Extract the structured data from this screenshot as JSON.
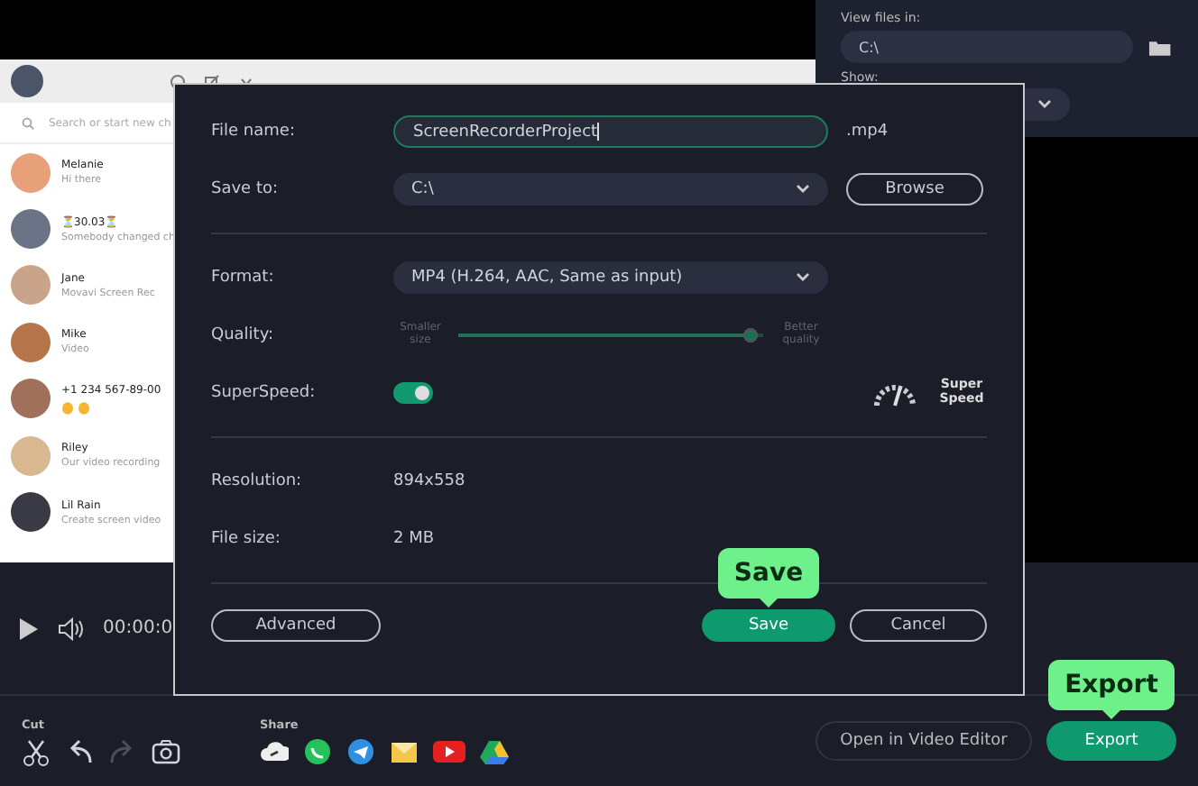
{
  "recording": {
    "search_placeholder": "Search or start new ch",
    "chats": [
      {
        "kind": "text",
        "name": "Melanie",
        "message": "Hi there",
        "color": "#e8a07a"
      },
      {
        "kind": "text",
        "name": "⏳30.03⏳",
        "message": "Somebody changed ch",
        "color": "#6a7486"
      },
      {
        "kind": "text",
        "name": "Jane",
        "message": "Movavi Screen Rec",
        "color": "#c9a48a"
      },
      {
        "kind": "text",
        "name": "Mike",
        "message": "Video",
        "color": "#b5744a"
      },
      {
        "kind": "emoji",
        "name": "+1 234 567-89-00",
        "color": "#a0705a"
      },
      {
        "kind": "text",
        "name": "Riley",
        "message": "Our video recording",
        "color": "#d8b890"
      },
      {
        "kind": "text",
        "name": "Lil Rain",
        "message": "Create screen video",
        "color": "#3a3a44"
      }
    ]
  },
  "files_panel": {
    "view_label": "View files in:",
    "folder": "C:\\",
    "show_label": "Show:"
  },
  "player": {
    "time": "00:00:0"
  },
  "dialog": {
    "file_name": {
      "label": "File name:",
      "value": "ScreenRecorderProject",
      "extension": ".mp4"
    },
    "save_to": {
      "label": "Save to:",
      "value": "C:\\",
      "button": "Browse"
    },
    "format": {
      "label": "Format:",
      "value": "MP4 (H.264, AAC, Same as input)"
    },
    "quality": {
      "label": "Quality:",
      "min_label": "Smaller size",
      "max_label": "Better quality",
      "level": 0.98
    },
    "superspeed": {
      "label": "SuperSpeed:",
      "on": true,
      "badge": "Super Speed"
    },
    "resolution": {
      "label": "Resolution:",
      "value": "894x558"
    },
    "file_size": {
      "label": "File size:",
      "value": "2 MB"
    },
    "buttons": {
      "advanced": "Advanced",
      "save": "Save",
      "save_callout": "Save",
      "cancel": "Cancel"
    }
  },
  "toolbar": {
    "cut_label": "Cut",
    "tools": [
      {
        "kind": "cut",
        "disabled": false
      },
      {
        "kind": "undo",
        "disabled": false
      },
      {
        "kind": "redo",
        "disabled": true
      },
      {
        "kind": "snapshot",
        "disabled": false
      }
    ],
    "share_label": "Share",
    "share": [
      {
        "kind": "cloud"
      },
      {
        "kind": "whatsapp"
      },
      {
        "kind": "telegram"
      },
      {
        "kind": "mail"
      },
      {
        "kind": "youtube"
      },
      {
        "kind": "drive"
      }
    ],
    "open_editor": "Open in Video Editor",
    "export": "Export",
    "export_callout": "Export"
  }
}
